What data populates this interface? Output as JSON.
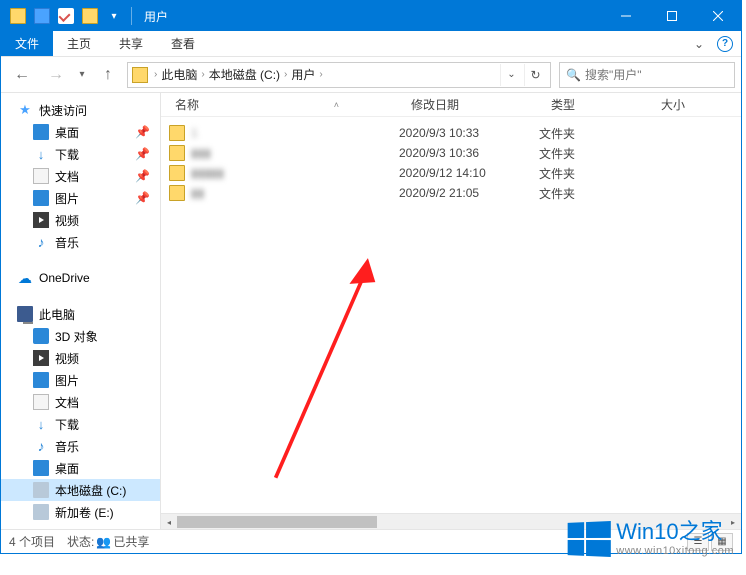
{
  "title": "用户",
  "menu": {
    "file": "文件",
    "home": "主页",
    "share": "共享",
    "view": "查看"
  },
  "breadcrumb": {
    "pc": "此电脑",
    "disk": "本地磁盘 (C:)",
    "users": "用户"
  },
  "search": {
    "placeholder": "搜索\"用户\""
  },
  "columns": {
    "name": "名称",
    "date": "修改日期",
    "type": "类型",
    "size": "大小"
  },
  "nav": {
    "quick": "快速访问",
    "desktop": "桌面",
    "downloads": "下载",
    "documents": "文档",
    "pictures": "图片",
    "videos": "视频",
    "music": "音乐",
    "onedrive": "OneDrive",
    "thispc": "此电脑",
    "obj3d": "3D 对象",
    "videos2": "视频",
    "pictures2": "图片",
    "documents2": "文档",
    "downloads2": "下载",
    "music2": "音乐",
    "desktop2": "桌面",
    "cdisk": "本地磁盘 (C:)",
    "edisk": "新加卷 (E:)"
  },
  "files": [
    {
      "name": "1  ",
      "date": "2020/9/3 10:33",
      "type": "文件夹"
    },
    {
      "name": "▮▮▮",
      "date": "2020/9/3 10:36",
      "type": "文件夹"
    },
    {
      "name": "▮▮▮▮▮",
      "date": "2020/9/12 14:10",
      "type": "文件夹"
    },
    {
      "name": "▮▮",
      "date": "2020/9/2 21:05",
      "type": "文件夹"
    }
  ],
  "status": {
    "count": "4 个项目",
    "state_label": "状态:",
    "shared": "已共享"
  },
  "watermark": {
    "main": "Win10之家",
    "sub": "www.win10xitong.com"
  }
}
